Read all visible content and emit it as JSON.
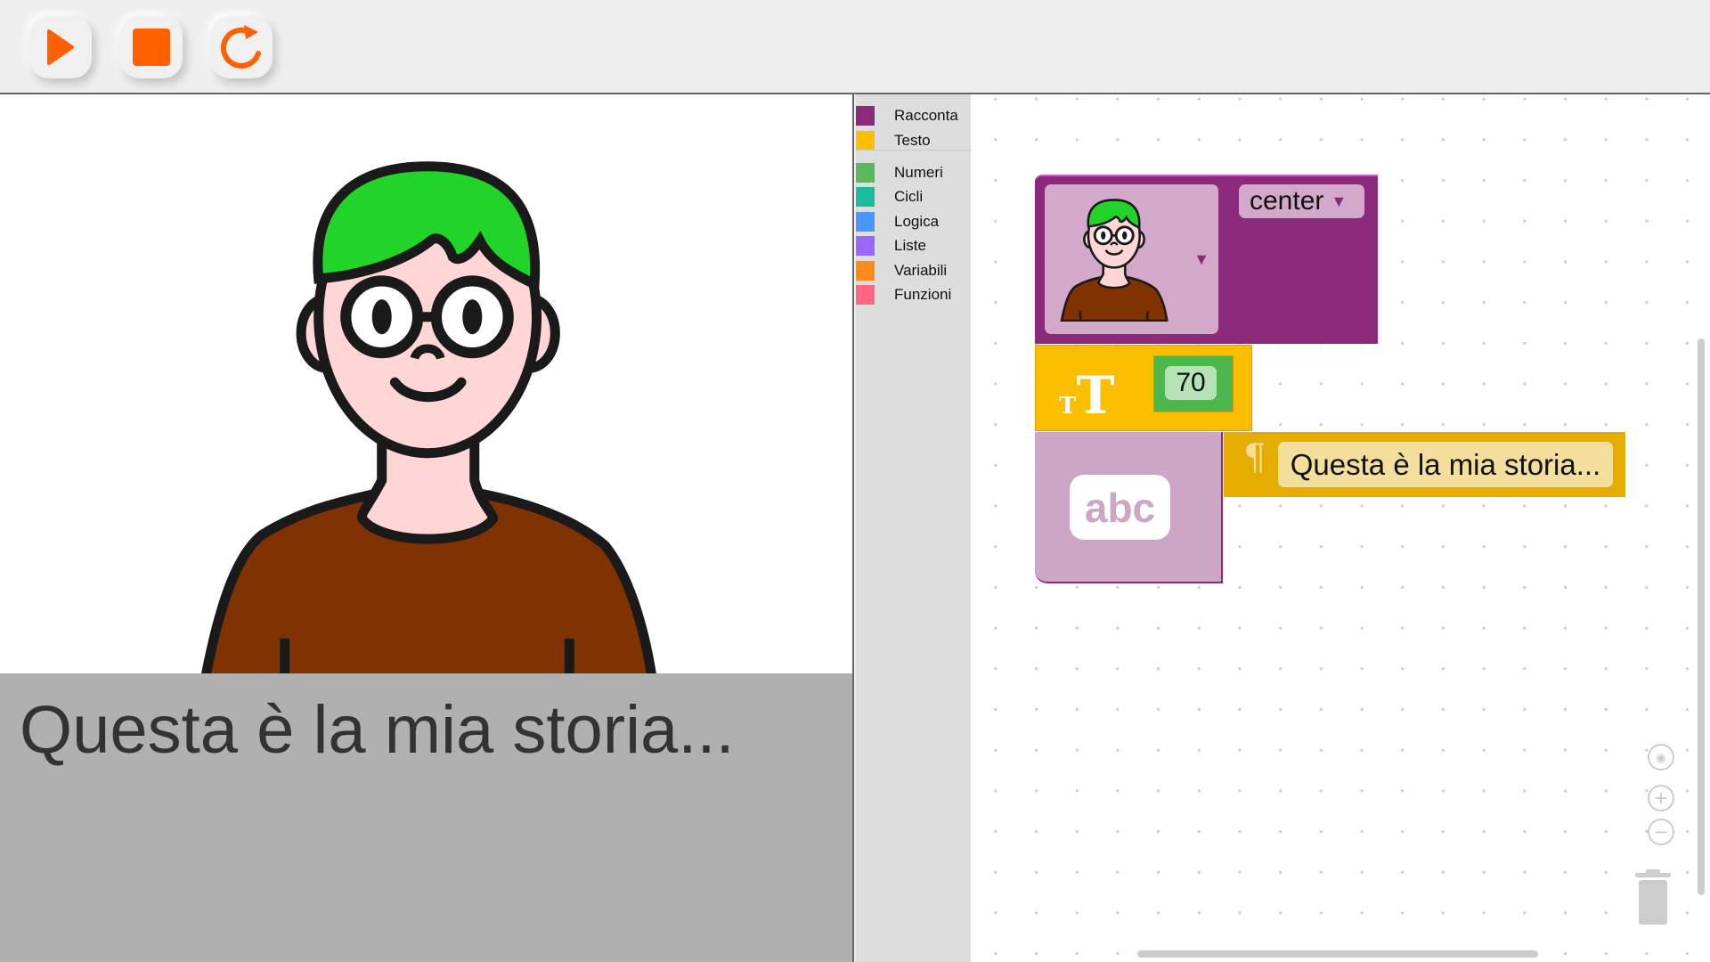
{
  "toolbar": {
    "buttons": [
      {
        "name": "play",
        "icon": "play-icon"
      },
      {
        "name": "stop",
        "icon": "stop-icon"
      },
      {
        "name": "restart",
        "icon": "restart-icon"
      }
    ],
    "accent": "#ff6000"
  },
  "stage": {
    "caption": "Questa è la mia storia..."
  },
  "toolbox": {
    "categories": [
      {
        "label": "Racconta",
        "color": "#8b2a7b"
      },
      {
        "label": "Testo",
        "color": "#fbbe00"
      },
      {
        "label": "Numeri",
        "color": "#5cb85c"
      },
      {
        "label": "Cicli",
        "color": "#1abc9c"
      },
      {
        "label": "Logica",
        "color": "#4c97ff"
      },
      {
        "label": "Liste",
        "color": "#9966ff"
      },
      {
        "label": "Variabili",
        "color": "#ff8c1a"
      },
      {
        "label": "Funzioni",
        "color": "#ff6680"
      }
    ]
  },
  "blocks": {
    "character": {
      "position": "center"
    },
    "text_size": {
      "value": "70"
    },
    "text": {
      "value": "Questa è la mia storia..."
    },
    "abc": {
      "label": "abc"
    }
  }
}
